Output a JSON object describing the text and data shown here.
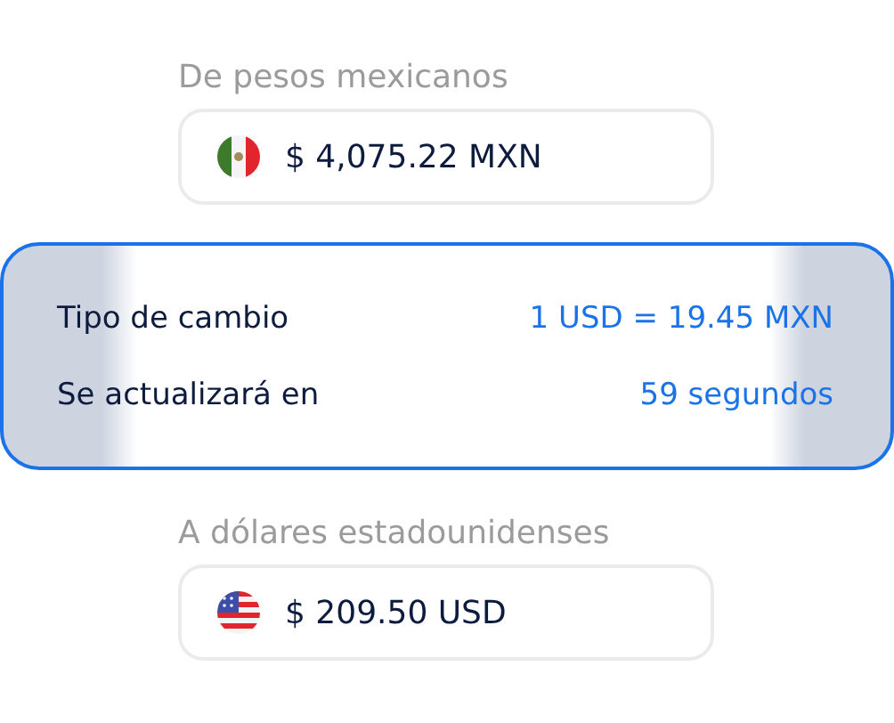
{
  "from": {
    "label": "De pesos mexicanos",
    "amount": "$ 4,075.22 MXN",
    "kind": "mexico"
  },
  "rate": [
    {
      "label": "Tipo de cambio",
      "value": "1 USD = 19.45 MXN"
    },
    {
      "label": "Se actualizará en",
      "value": "59 segundos"
    }
  ],
  "to": {
    "label": "A dólares estadounidenses",
    "amount": "$ 209.50 USD",
    "kind": "usa"
  }
}
